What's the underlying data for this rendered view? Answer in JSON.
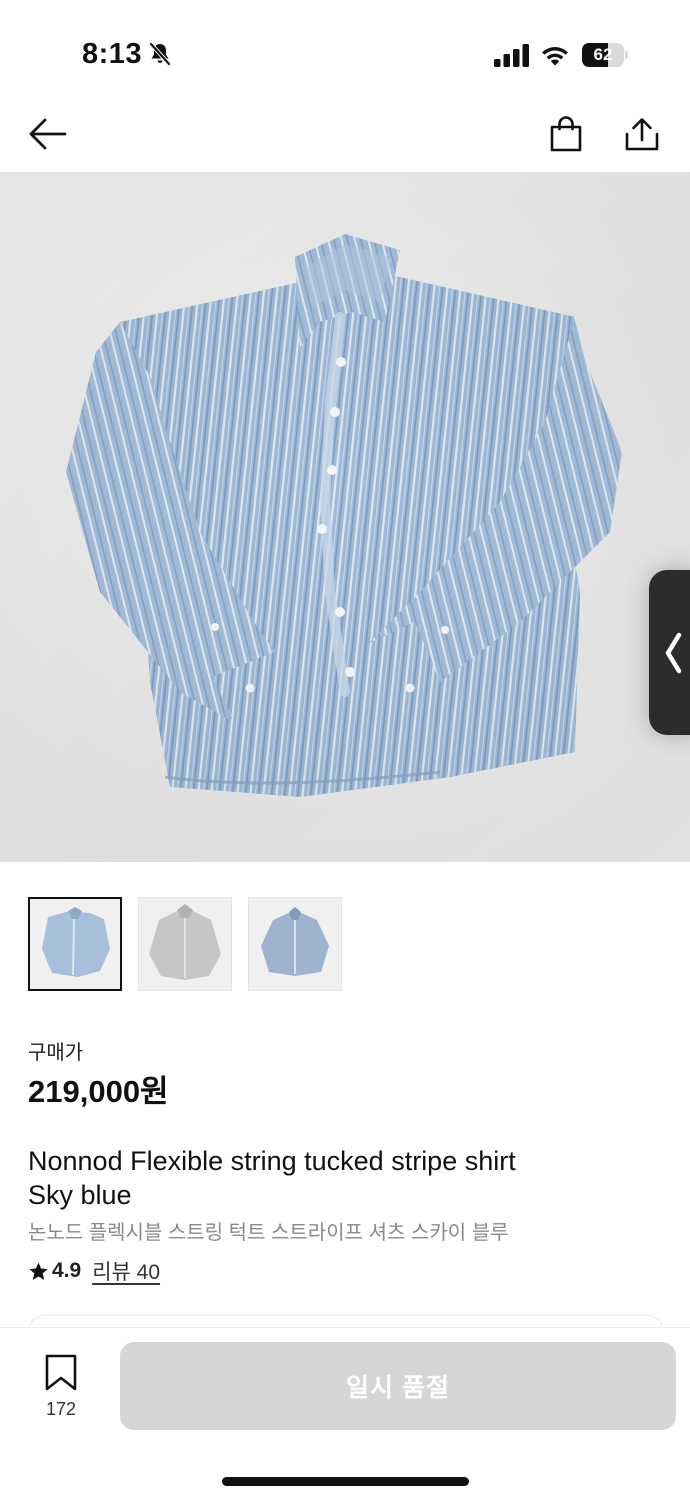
{
  "status_bar": {
    "time": "8:13",
    "battery_percent": "62",
    "battery_level": 0.62,
    "icons": [
      "bell-slash-icon",
      "cellular-signal-icon",
      "wifi-icon",
      "battery-icon"
    ]
  },
  "nav": {
    "icons": [
      "back-arrow-icon",
      "shopping-bag-icon",
      "share-icon"
    ]
  },
  "product": {
    "image_count": 3,
    "selected_image": 1,
    "price_label": "구매가",
    "price": "219,000원",
    "title_en_line1": "Nonnod Flexible string tucked stripe shirt",
    "title_en_line2": "Sky blue",
    "title_ko": "논노드 플렉시블 스트링 턱트 스트라이프 셔츠 스카이 블루",
    "rating": "4.9",
    "reviews": "리뷰 40"
  },
  "bottom_bar": {
    "wish_count": "172",
    "action_label": "일시 품절"
  },
  "colors": {
    "shirt_blue": "#9fb9d6",
    "shirt_stripe": "#dfe9f4",
    "disabled_button": "#d6d6d6",
    "text_muted": "#8a8a8a"
  }
}
